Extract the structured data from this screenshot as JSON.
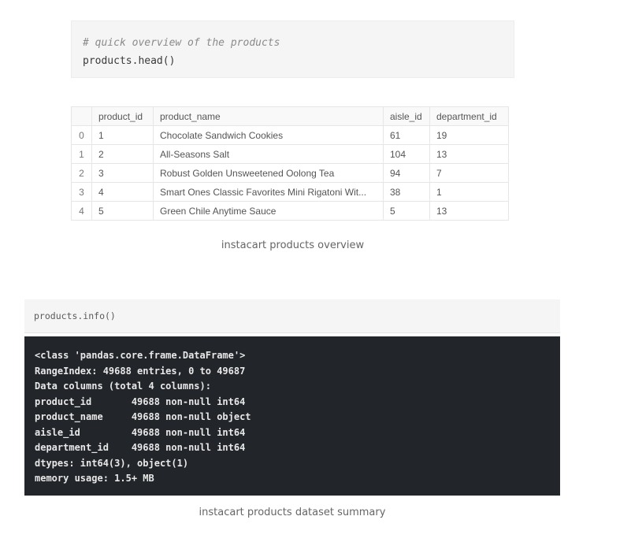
{
  "code_cell_1": {
    "comment": "# quick overview of the products",
    "code": "products.head()"
  },
  "table": {
    "columns": [
      "",
      "product_id",
      "product_name",
      "aisle_id",
      "department_id"
    ],
    "rows": [
      [
        "0",
        "1",
        "Chocolate Sandwich Cookies",
        "61",
        "19"
      ],
      [
        "1",
        "2",
        "All-Seasons Salt",
        "104",
        "13"
      ],
      [
        "2",
        "3",
        "Robust Golden Unsweetened Oolong Tea",
        "94",
        "7"
      ],
      [
        "3",
        "4",
        "Smart Ones Classic Favorites Mini Rigatoni Wit...",
        "38",
        "1"
      ],
      [
        "4",
        "5",
        "Green Chile Anytime Sauce",
        "5",
        "13"
      ]
    ]
  },
  "caption_1": "instacart products overview",
  "code_cell_2": {
    "code": "products.info()"
  },
  "output": {
    "lines": [
      "<class 'pandas.core.frame.DataFrame'>",
      "RangeIndex: 49688 entries, 0 to 49687",
      "Data columns (total 4 columns):",
      "product_id       49688 non-null int64",
      "product_name     49688 non-null object",
      "aisle_id         49688 non-null int64",
      "department_id    49688 non-null int64",
      "dtypes: int64(3), object(1)",
      "memory usage: 1.5+ MB"
    ]
  },
  "caption_2": "instacart products dataset summary"
}
